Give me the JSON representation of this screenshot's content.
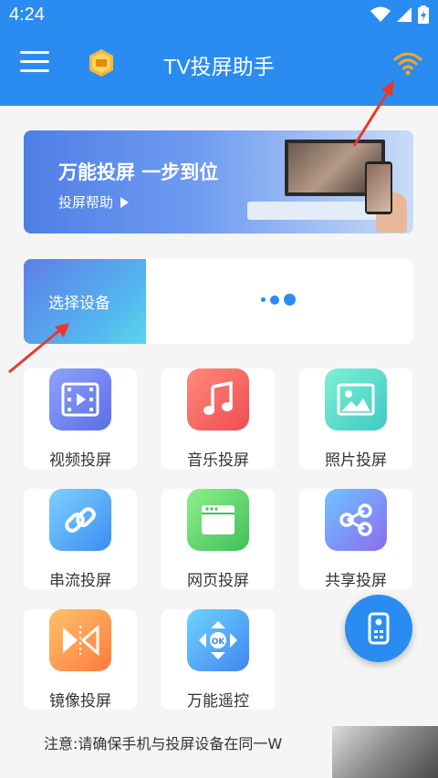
{
  "status_bar": {
    "time": "4:24"
  },
  "app_bar": {
    "title": "TV投屏助手"
  },
  "banner": {
    "title": "万能投屏 一步到位",
    "help_link": "投屏帮助"
  },
  "device": {
    "select_label": "选择设备"
  },
  "features": [
    {
      "label": "视频投屏"
    },
    {
      "label": "音乐投屏"
    },
    {
      "label": "照片投屏"
    },
    {
      "label": "串流投屏"
    },
    {
      "label": "网页投屏"
    },
    {
      "label": "共享投屏"
    },
    {
      "label": "镜像投屏"
    },
    {
      "label": "万能遥控"
    }
  ],
  "notice": "注意:请确保手机与投屏设备在同一W",
  "colors": {
    "primary": "#2a8cf0",
    "annotation": "#e8392c",
    "wifi": "#f5a623"
  }
}
